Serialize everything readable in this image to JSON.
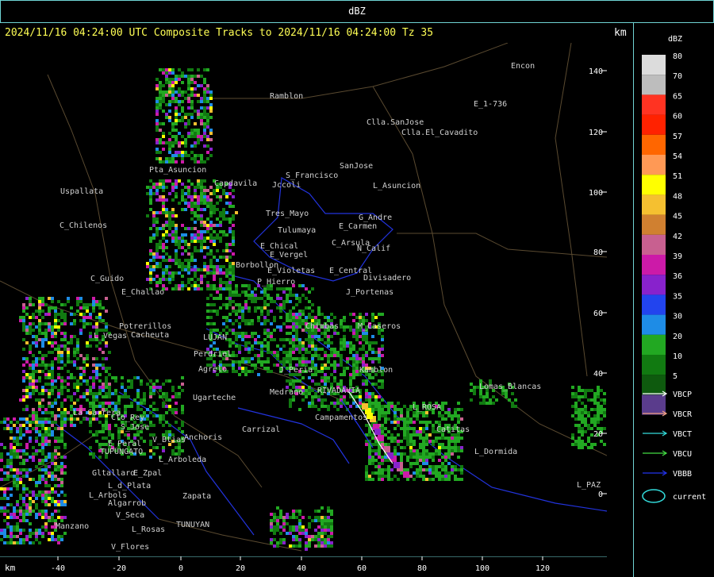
{
  "topbar": {
    "title": "dBZ"
  },
  "header": {
    "text": "2024/11/16 04:24:00 UTC Composite Tracks to 2024/11/16 04:24:00 Tz 35",
    "km": "km"
  },
  "axes": {
    "x_unit": "km",
    "x_ticks": [
      "-40",
      "-20",
      "0",
      "20",
      "40",
      "60",
      "80",
      "100",
      "120"
    ],
    "y_ticks": [
      "140",
      "120",
      "100",
      "80",
      "60",
      "40",
      "20",
      "0"
    ]
  },
  "legend": {
    "title": "dBZ",
    "scale": [
      {
        "value": "80",
        "color": "#dcdcdc"
      },
      {
        "value": "70",
        "color": "#bdbdbd"
      },
      {
        "value": "65",
        "color": "#ff3322"
      },
      {
        "value": "60",
        "color": "#ff2200"
      },
      {
        "value": "57",
        "color": "#ff6600"
      },
      {
        "value": "54",
        "color": "#ff9955"
      },
      {
        "value": "51",
        "color": "#ffff00"
      },
      {
        "value": "48",
        "color": "#f5c030"
      },
      {
        "value": "45",
        "color": "#d08030"
      },
      {
        "value": "42",
        "color": "#c86090"
      },
      {
        "value": "39",
        "color": "#cc1aa8"
      },
      {
        "value": "36",
        "color": "#8822cc"
      },
      {
        "value": "35",
        "color": "#2244ee"
      },
      {
        "value": "30",
        "color": "#1e8ce6"
      },
      {
        "value": "20",
        "color": "#22a822"
      },
      {
        "value": "10",
        "color": "#117a11"
      },
      {
        "value": "5",
        "color": "#0e5a0e"
      },
      {
        "value": "",
        "color": "#5a3c8c"
      }
    ],
    "tracks": [
      {
        "label": "VBCP",
        "color": "#ffffff"
      },
      {
        "label": "VBCR",
        "color": "#f0a080"
      },
      {
        "label": "VBCT",
        "color": "#33dddd"
      },
      {
        "label": "VBCU",
        "color": "#44dd44"
      },
      {
        "label": "VBBB",
        "color": "#2233ee"
      }
    ],
    "current": {
      "label": "current",
      "color": "#33dddd"
    }
  },
  "places": [
    {
      "name": "Ramblon"
    },
    {
      "name": "Encon"
    },
    {
      "name": "E_1-736"
    },
    {
      "name": "Clla.SanJose"
    },
    {
      "name": "Clla.El_Cavadito"
    },
    {
      "name": "SanJose"
    },
    {
      "name": "S_Francisco"
    },
    {
      "name": "Jccoli"
    },
    {
      "name": "L_Asuncion"
    },
    {
      "name": "Uspallata"
    },
    {
      "name": "Pta_Asuncion"
    },
    {
      "name": "Capdavila"
    },
    {
      "name": "Tres_Mayo"
    },
    {
      "name": "G_Andre"
    },
    {
      "name": "Tulumaya"
    },
    {
      "name": "E_Carmen"
    },
    {
      "name": "C_Chilenos"
    },
    {
      "name": "E_Chical"
    },
    {
      "name": "C_Arsula"
    },
    {
      "name": "N_Calif"
    },
    {
      "name": "E_Vergel"
    },
    {
      "name": "Borbollon"
    },
    {
      "name": "E_Central"
    },
    {
      "name": "E_Violetas"
    },
    {
      "name": "C_Guido"
    },
    {
      "name": "P_Hierro"
    },
    {
      "name": "Divisadero"
    },
    {
      "name": "E_Challao"
    },
    {
      "name": "J_Portenas"
    },
    {
      "name": "Chimbas"
    },
    {
      "name": "M_Caseros"
    },
    {
      "name": "Potrerillos"
    },
    {
      "name": "L_Vegas"
    },
    {
      "name": "Cacheuta"
    },
    {
      "name": "LUJAN"
    },
    {
      "name": "Perdriel"
    },
    {
      "name": "Agrelo"
    },
    {
      "name": "J_Peria"
    },
    {
      "name": "Ugarteche"
    },
    {
      "name": "Medrano"
    },
    {
      "name": "Lomas_Blancas"
    },
    {
      "name": "La_Carrera"
    },
    {
      "name": "Cto_Rey"
    },
    {
      "name": "S_Jose"
    },
    {
      "name": "Anchoris"
    },
    {
      "name": "Carrizal"
    },
    {
      "name": "Campamentos"
    },
    {
      "name": "Catitas"
    },
    {
      "name": "E_Peral"
    },
    {
      "name": "V_Btias"
    },
    {
      "name": "TUPUNGATO"
    },
    {
      "name": "L_Arboleda"
    },
    {
      "name": "L_Dormida"
    },
    {
      "name": "Gltallaro"
    },
    {
      "name": "E_Zpal"
    },
    {
      "name": "L_d_Plata"
    },
    {
      "name": "L_Arbols"
    },
    {
      "name": "Zapata"
    },
    {
      "name": "Algarrob"
    },
    {
      "name": "V_Seca"
    },
    {
      "name": "Manzano"
    },
    {
      "name": "L_Rosas"
    },
    {
      "name": "TUNUYAN"
    },
    {
      "name": "V_Flores"
    },
    {
      "name": "L_PAZ"
    },
    {
      "name": "Kamblon"
    },
    {
      "name": "RIVADAVIA"
    },
    {
      "name": "L_ROSA"
    }
  ]
}
